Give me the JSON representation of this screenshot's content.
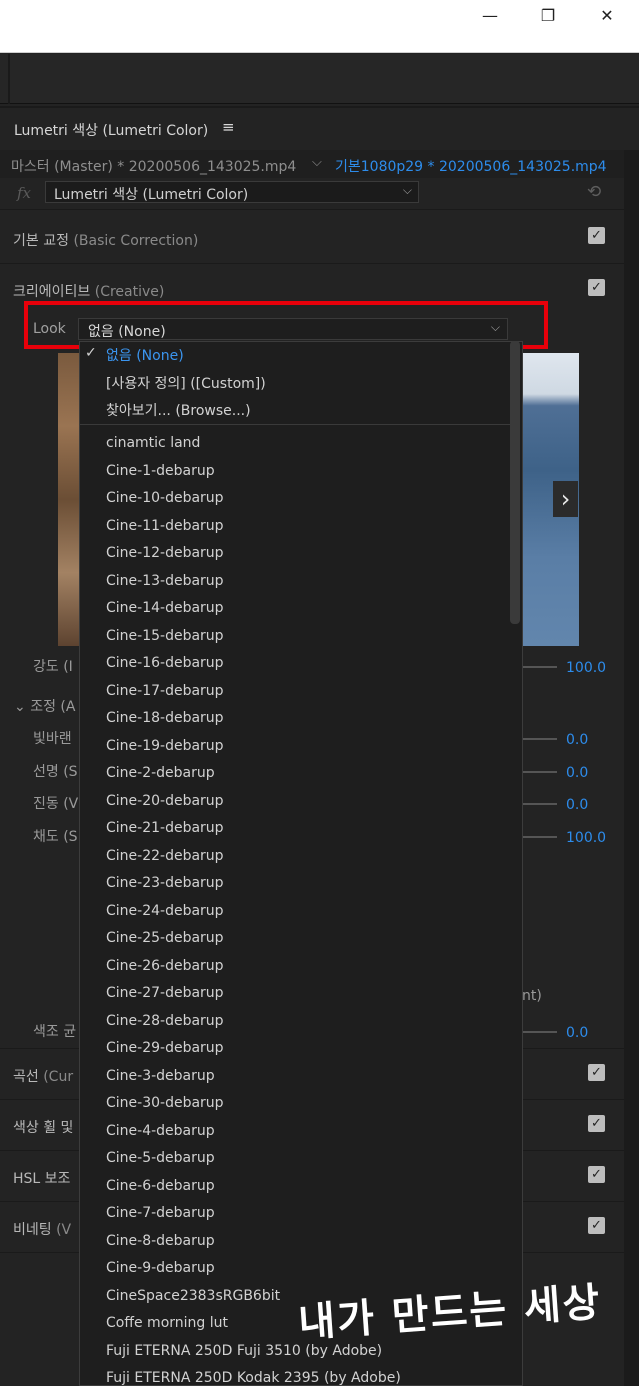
{
  "window": {
    "minimize": "—",
    "maximize": "❐",
    "close": "✕"
  },
  "panel": {
    "title": "Lumetri 색상 (Lumetri Color)",
    "menu_icon": "≡"
  },
  "clip": {
    "master": "마스터 (Master) * 20200506_143025.mp4",
    "sequence": "기본1080p29 * 20200506_143025.mp4"
  },
  "effect": {
    "fx": "fx",
    "name": "Lumetri 색상 (Lumetri Color)"
  },
  "sections": {
    "basic": {
      "ko": "기본 교정",
      "en": "(Basic Correction)"
    },
    "creative": {
      "ko": "크리에이티브",
      "en": "(Creative)"
    },
    "curves": {
      "ko": "곡선",
      "en": "(Cur"
    },
    "wheels": {
      "ko": "색상 휠 및",
      "en": ""
    },
    "hsl": {
      "ko": "HSL 보조",
      "en": ""
    },
    "vignette": {
      "ko": "비네팅",
      "en": "(V"
    }
  },
  "look": {
    "label": "Look",
    "value": "없음 (None)"
  },
  "params": {
    "intensity": {
      "label": "강도 (I",
      "value": "100.0"
    },
    "adjust": {
      "label": "조정 (A"
    },
    "faded": {
      "label": "빛바랜",
      "value": "0.0"
    },
    "sharpen": {
      "label": "선명 (S",
      "value": "0.0"
    },
    "vibrance": {
      "label": "진동 (V",
      "value": "0.0"
    },
    "saturation": {
      "label": "채도 (S",
      "value": "100.0"
    },
    "tint_balance": {
      "label": "색조 균",
      "value": "0.0"
    },
    "trailing_text": "nt)"
  },
  "dropdown": {
    "check": "✓",
    "special": [
      "없음 (None)",
      "[사용자 정의] ([Custom])",
      "찾아보기... (Browse...)"
    ],
    "items": [
      "cinamtic land",
      "Cine-1-debarup",
      "Cine-10-debarup",
      "Cine-11-debarup",
      "Cine-12-debarup",
      "Cine-13-debarup",
      "Cine-14-debarup",
      "Cine-15-debarup",
      "Cine-16-debarup",
      "Cine-17-debarup",
      "Cine-18-debarup",
      "Cine-19-debarup",
      "Cine-2-debarup",
      "Cine-20-debarup",
      "Cine-21-debarup",
      "Cine-22-debarup",
      "Cine-23-debarup",
      "Cine-24-debarup",
      "Cine-25-debarup",
      "Cine-26-debarup",
      "Cine-27-debarup",
      "Cine-28-debarup",
      "Cine-29-debarup",
      "Cine-3-debarup",
      "Cine-30-debarup",
      "Cine-4-debarup",
      "Cine-5-debarup",
      "Cine-6-debarup",
      "Cine-7-debarup",
      "Cine-8-debarup",
      "Cine-9-debarup",
      "CineSpace2383sRGB6bit",
      "Coffe morning lut",
      "Fuji ETERNA 250D Fuji 3510 (by Adobe)",
      "Fuji ETERNA 250D Kodak 2395 (by Adobe)"
    ]
  },
  "watermark": "내가 만드는 세상",
  "colors": {
    "accent": "#2d8ceb",
    "highlight": "#e8000a",
    "panel_bg": "#232323"
  }
}
